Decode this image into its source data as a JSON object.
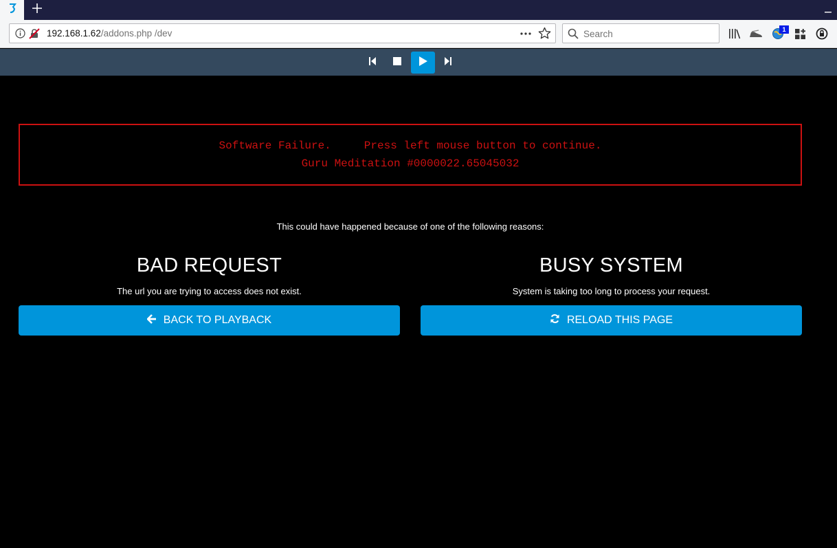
{
  "browser": {
    "url_host": "192.168.1.62",
    "url_path": "/addons.php /dev",
    "search_placeholder": "Search",
    "notification_count": "1"
  },
  "player": {
    "controls": [
      "previous",
      "stop",
      "play",
      "next"
    ]
  },
  "error": {
    "line1": "Software Failure.     Press left mouse button to continue.",
    "line2": "Guru Meditation #0000022.65045032",
    "color": "#cc1111"
  },
  "main": {
    "reasons_intro": "This could have happened because of one of the following reasons:",
    "left": {
      "title": "BAD REQUEST",
      "desc": "The url you are trying to access does not exist.",
      "button": "BACK TO PLAYBACK",
      "button_icon": "arrow-left-icon"
    },
    "right": {
      "title": "BUSY SYSTEM",
      "desc": "System is taking too long to process your request.",
      "button": "RELOAD THIS PAGE",
      "button_icon": "refresh-icon"
    }
  },
  "colors": {
    "accent": "#0095db",
    "player_bar": "#34495e",
    "tab_strip": "#1d1f40"
  }
}
